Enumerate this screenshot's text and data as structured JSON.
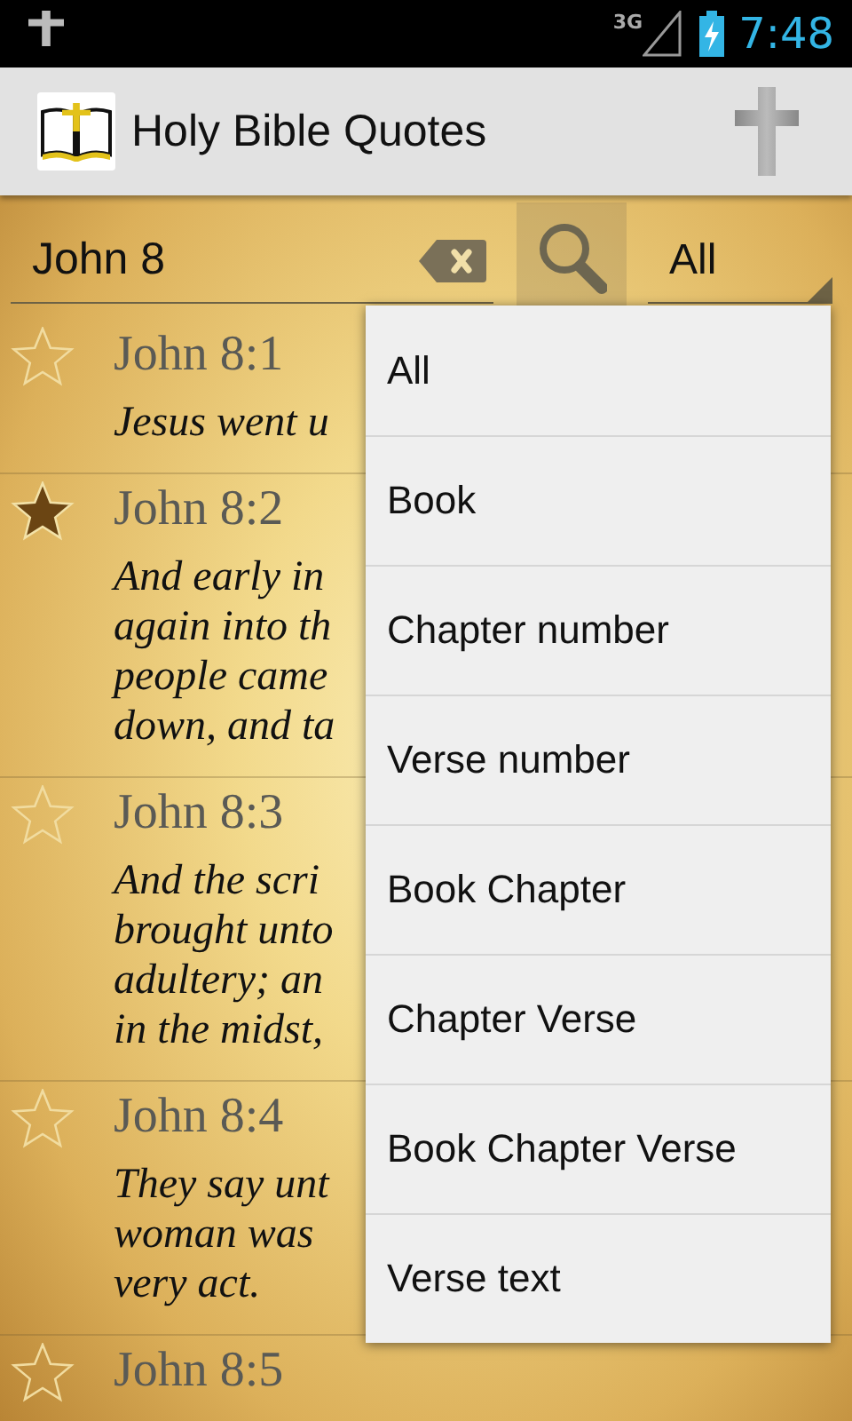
{
  "status_bar": {
    "network": "3G",
    "time": "7:48"
  },
  "action_bar": {
    "title": "Holy Bible Quotes"
  },
  "search": {
    "value": "John 8",
    "filter": "All"
  },
  "verses": [
    {
      "reference": "John 8:1",
      "starred": false,
      "lines": [
        "Jesus went u"
      ]
    },
    {
      "reference": "John 8:2",
      "starred": true,
      "lines": [
        "And early in",
        "again into th",
        "people came",
        "down, and ta"
      ]
    },
    {
      "reference": "John 8:3",
      "starred": false,
      "lines": [
        "And the scri",
        "brought unto",
        "adultery; an",
        "in the midst,"
      ]
    },
    {
      "reference": "John 8:4",
      "starred": false,
      "lines": [
        "They say unt",
        "woman was",
        "very act."
      ]
    },
    {
      "reference": "John 8:5",
      "starred": false
    }
  ],
  "filter_menu": {
    "options": [
      "All",
      "Book",
      "Chapter number",
      "Verse number",
      "Book Chapter",
      "Chapter Verse",
      "Book Chapter Verse",
      "Verse text"
    ]
  }
}
